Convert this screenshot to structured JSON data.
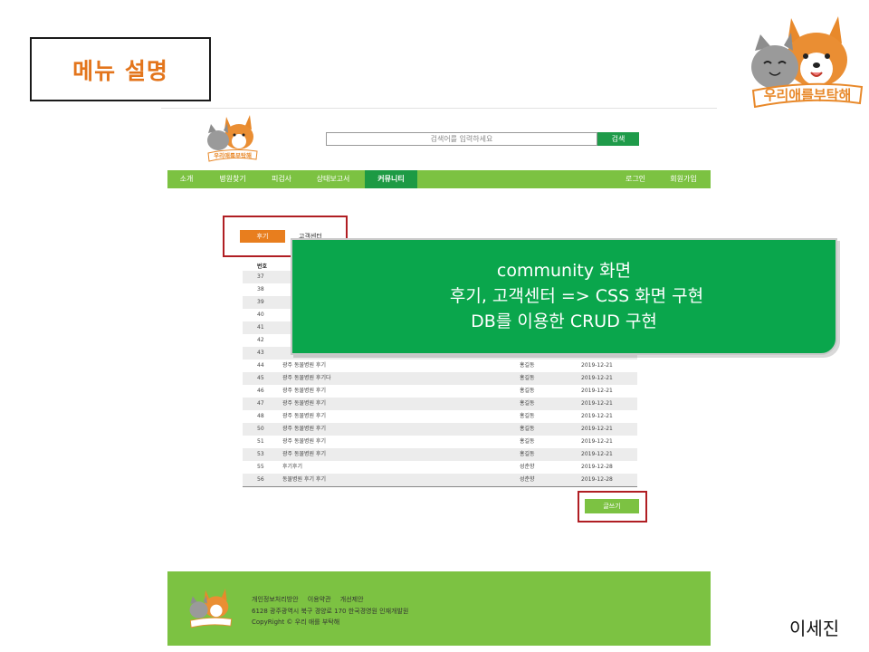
{
  "slide": {
    "title": "메뉴 설명",
    "presenter": "이세진",
    "brand_logo_text": "우리애를부탁해",
    "brand_logo_icon": "cat-dog-logo-icon"
  },
  "site": {
    "logo_text": "우리애를부탁해",
    "search_placeholder": "검색어를 입력하세요",
    "search_button": "검색",
    "nav": {
      "left": [
        "소개",
        "병원찾기",
        "피검사",
        "상태보고서",
        "커뮤니티"
      ],
      "active": "커뮤니티",
      "right": [
        "로그인",
        "회원가입"
      ]
    },
    "tabs": {
      "reviews": "후기",
      "customer_center": "고객센터"
    },
    "table": {
      "header_number": "번호",
      "rows": [
        {
          "num": "37",
          "title": "",
          "writer": "",
          "date": ""
        },
        {
          "num": "38",
          "title": "",
          "writer": "",
          "date": ""
        },
        {
          "num": "39",
          "title": "",
          "writer": "",
          "date": ""
        },
        {
          "num": "40",
          "title": "",
          "writer": "",
          "date": ""
        },
        {
          "num": "41",
          "title": "",
          "writer": "",
          "date": ""
        },
        {
          "num": "42",
          "title": "",
          "writer": "",
          "date": ""
        },
        {
          "num": "43",
          "title": "",
          "writer": "",
          "date": ""
        },
        {
          "num": "44",
          "title": "광주 동물병원 후기",
          "writer": "홍길동",
          "date": "2019-12-21"
        },
        {
          "num": "45",
          "title": "광주 동물병원 후기다",
          "writer": "홍길동",
          "date": "2019-12-21"
        },
        {
          "num": "46",
          "title": "광주 동물병원 후기",
          "writer": "홍길동",
          "date": "2019-12-21"
        },
        {
          "num": "47",
          "title": "광주 동물병원 후기",
          "writer": "홍길동",
          "date": "2019-12-21"
        },
        {
          "num": "48",
          "title": "광주 동물병원 후기",
          "writer": "홍길동",
          "date": "2019-12-21"
        },
        {
          "num": "50",
          "title": "광주 동물병원 후기",
          "writer": "홍길동",
          "date": "2019-12-21"
        },
        {
          "num": "51",
          "title": "광주 동물병원 후기",
          "writer": "홍길동",
          "date": "2019-12-21"
        },
        {
          "num": "53",
          "title": "광주 동물병원 후기",
          "writer": "홍길동",
          "date": "2019-12-21"
        },
        {
          "num": "55",
          "title": "후기후기",
          "writer": "성춘향",
          "date": "2019-12-28"
        },
        {
          "num": "56",
          "title": "동물병원 후기 후기",
          "writer": "성춘향",
          "date": "2019-12-28"
        }
      ]
    },
    "write_button": "글쓰기",
    "footer": {
      "links": [
        "개인정보처리방안",
        "이용약관",
        "개선제안"
      ],
      "address": "6128 광주광역시 북구 경양로 170 한국경영원 인재개발원",
      "copyright": "CopyRight © 우리 애를 부탁해"
    }
  },
  "callout": {
    "line1": "community 화면",
    "line2": "후기, 고객센터 => CSS 화면 구현",
    "line3": "DB를 이용한 CRUD 구현"
  },
  "colors": {
    "accent_orange": "#e87e1e",
    "nav_green": "#7cc242",
    "dark_green": "#1d9a44",
    "callout_green": "#0aa64c",
    "highlight_red": "#b01e23"
  }
}
